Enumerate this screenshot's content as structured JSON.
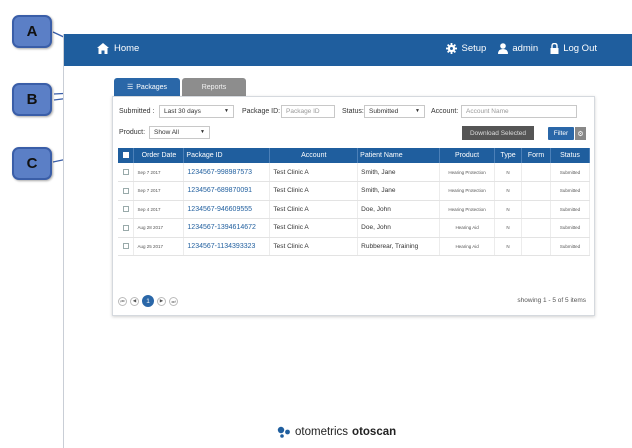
{
  "callouts": [
    "A",
    "B",
    "C"
  ],
  "topbar": {
    "home_label": "Home",
    "setup_label": "Setup",
    "user_label": "admin",
    "logout_label": "Log Out",
    "bg_color": "#1f5e9e"
  },
  "tabs": [
    {
      "label": "Packages",
      "active": true
    },
    {
      "label": "Reports",
      "active": false
    }
  ],
  "filters": {
    "submitted_label": "Submitted :",
    "submitted_value": "Last 30 days",
    "package_id_label": "Package ID:",
    "package_id_placeholder": "Package ID",
    "status_label": "Status:",
    "status_value": "Submitted",
    "account_label": "Account:",
    "account_placeholder": "Account Name",
    "product_label": "Product:",
    "product_value": "Show All",
    "download_label": "Download Selected",
    "filter_label": "Filter"
  },
  "table": {
    "columns": [
      "Order Date",
      "Package ID",
      "Account",
      "Patient Name",
      "Product",
      "Type",
      "Form",
      "Status"
    ],
    "rows": [
      {
        "date": "Sep 7 2017",
        "package_id": "1234567-998987573",
        "account": "Test Clinic A",
        "patient": "Smith, Jane",
        "product": "Hearing Protection",
        "type": "N",
        "form": "",
        "status": "Submitted"
      },
      {
        "date": "Sep 7 2017",
        "package_id": "1234567-689870091",
        "account": "Test Clinic A",
        "patient": "Smith, Jane",
        "product": "Hearing Protection",
        "type": "N",
        "form": "",
        "status": "Submitted"
      },
      {
        "date": "Sep 4 2017",
        "package_id": "1234567-946609555",
        "account": "Test Clinic A",
        "patient": "Doe, John",
        "product": "Hearing Protection",
        "type": "N",
        "form": "",
        "status": "Submitted"
      },
      {
        "date": "Aug 28 2017",
        "package_id": "1234567-1394614672",
        "account": "Test Clinic A",
        "patient": "Doe, John",
        "product": "Hearing Aid",
        "type": "N",
        "form": "",
        "status": "Submitted"
      },
      {
        "date": "Aug 25 2017",
        "package_id": "1234567-1134393323",
        "account": "Test Clinic A",
        "patient": "Rubberear, Training",
        "product": "Hearing Aid",
        "type": "N",
        "form": "",
        "status": "Submitted"
      }
    ]
  },
  "pager": {
    "current_page": "1",
    "summary": "showing 1 - 5 of 5 items"
  },
  "footer": {
    "brand_name": "otometrics",
    "product_name": "otoscan"
  }
}
